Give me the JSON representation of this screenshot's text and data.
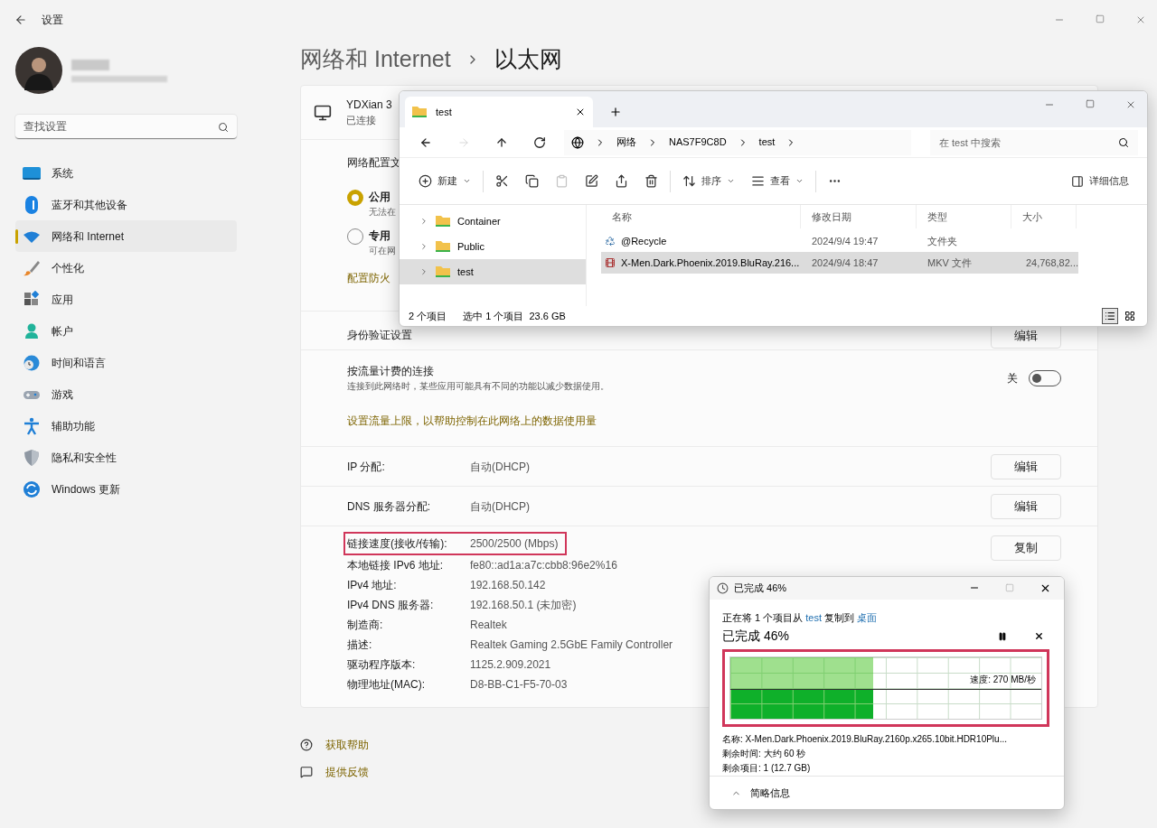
{
  "settings": {
    "title": "设置",
    "search": {
      "placeholder": "查找设置"
    },
    "nav": [
      {
        "label": "系统",
        "selected": false
      },
      {
        "label": "蓝牙和其他设备",
        "selected": false
      },
      {
        "label": "网络和 Internet",
        "selected": true
      },
      {
        "label": "个性化",
        "selected": false
      },
      {
        "label": "应用",
        "selected": false
      },
      {
        "label": "帐户",
        "selected": false
      },
      {
        "label": "时间和语言",
        "selected": false
      },
      {
        "label": "游戏",
        "selected": false
      },
      {
        "label": "辅助功能",
        "selected": false
      },
      {
        "label": "隐私和安全性",
        "selected": false
      },
      {
        "label": "Windows 更新",
        "selected": false
      }
    ],
    "breadcrumb": [
      "网络和 Internet",
      "以太网"
    ],
    "adapter": {
      "name": "YDXian 3",
      "status": "已连接"
    },
    "profile": {
      "heading": "网络配置文",
      "options": [
        {
          "label": "公用",
          "desc": "无法在",
          "selected": true
        },
        {
          "label": "专用",
          "desc": "可在网",
          "selected": false
        }
      ],
      "link": "配置防火"
    },
    "auth": {
      "label": "身份验证设置",
      "button": "编辑"
    },
    "metered": {
      "title": "按流量计费的连接",
      "desc": "连接到此网络时，某些应用可能具有不同的功能以减少数据使用。",
      "state_label": "关",
      "on": false,
      "link": "设置流量上限，以帮助控制在此网络上的数据使用量"
    },
    "assign_rows": [
      {
        "label": "IP 分配:",
        "value": "自动(DHCP)",
        "button": "编辑"
      },
      {
        "label": "DNS 服务器分配:",
        "value": "自动(DHCP)",
        "button": "编辑"
      }
    ],
    "properties": [
      {
        "label": "链接速度(接收/传输):",
        "value": "2500/2500 (Mbps)",
        "highlighted": true
      },
      {
        "label": "本地链接 IPv6 地址:",
        "value": "fe80::ad1a:a7c:cbb8:96e2%16",
        "highlighted": false
      },
      {
        "label": "IPv4 地址:",
        "value": "192.168.50.142",
        "highlighted": false
      },
      {
        "label": "IPv4 DNS 服务器:",
        "value": "192.168.50.1 (未加密)",
        "highlighted": false
      },
      {
        "label": "制造商:",
        "value": "Realtek",
        "highlighted": false
      },
      {
        "label": "描述:",
        "value": "Realtek Gaming 2.5GbE Family Controller",
        "highlighted": false
      },
      {
        "label": "驱动程序版本:",
        "value": "1125.2.909.2021",
        "highlighted": false
      },
      {
        "label": "物理地址(MAC):",
        "value": "D8-BB-C1-F5-70-03",
        "highlighted": false
      }
    ],
    "copy_button": "复制",
    "help_links": [
      "获取帮助",
      "提供反馈"
    ]
  },
  "explorer": {
    "tabs": [
      {
        "label": "test",
        "selected": true
      }
    ],
    "nav_buttons": [
      {
        "kind": "back",
        "disabled": false
      },
      {
        "kind": "forward",
        "disabled": true
      },
      {
        "kind": "up",
        "disabled": false
      },
      {
        "kind": "refresh",
        "disabled": false
      }
    ],
    "path": [
      "网络",
      "NAS7F9C8D",
      "test"
    ],
    "search": {
      "placeholder": "在 test 中搜索"
    },
    "toolbar": [
      {
        "kind": "new",
        "label": "新建",
        "disabled": false
      },
      {
        "kind": "cut",
        "disabled": false
      },
      {
        "kind": "copy",
        "disabled": false
      },
      {
        "kind": "paste",
        "disabled": true
      },
      {
        "kind": "rename",
        "disabled": false
      },
      {
        "kind": "share",
        "disabled": false
      },
      {
        "kind": "delete",
        "disabled": false
      },
      {
        "kind": "sort",
        "label": "排序",
        "disabled": false
      },
      {
        "kind": "view",
        "label": "查看",
        "disabled": false
      },
      {
        "kind": "more",
        "disabled": false
      }
    ],
    "details_button": "详细信息",
    "tree": [
      {
        "label": "Container",
        "selected": false,
        "expanded": false
      },
      {
        "label": "Public",
        "selected": false,
        "expanded": false
      },
      {
        "label": "test",
        "selected": true,
        "expanded": false
      }
    ],
    "columns": [
      "名称",
      "修改日期",
      "类型",
      "大小"
    ],
    "rows": [
      {
        "kind": "recycle",
        "name": "@Recycle",
        "date": "2024/9/4 19:47",
        "type": "文件夹",
        "selected": false
      },
      {
        "kind": "video",
        "name": "X-Men.Dark.Phoenix.2019.BluRay.216...",
        "date": "2024/9/4 18:47",
        "type": "MKV 文件",
        "size": "24,768,82...",
        "selected": true
      }
    ],
    "status": {
      "count": "2 个项目",
      "selection": "选中 1 个项目",
      "size": "23.6 GB"
    },
    "views": [
      {
        "kind": "details",
        "selected": true
      },
      {
        "kind": "tiles",
        "selected": false
      }
    ]
  },
  "copy_dialog": {
    "title": "已完成 46%",
    "from_prefix": "正在将 1 个项目从",
    "source": "test",
    "middle": "复制到",
    "destination": "桌面",
    "heading": "已完成 46%",
    "level": 0.46,
    "highlighted": true,
    "speed": "速度: 270 MB/秒",
    "details": [
      "名称: X-Men.Dark.Phoenix.2019.BluRay.2160p.x265.10bit.HDR10Plu...",
      "剩余时间: 大约 60 秒",
      "剩余项目: 1 (12.7 GB)"
    ],
    "toggle": "简略信息"
  }
}
